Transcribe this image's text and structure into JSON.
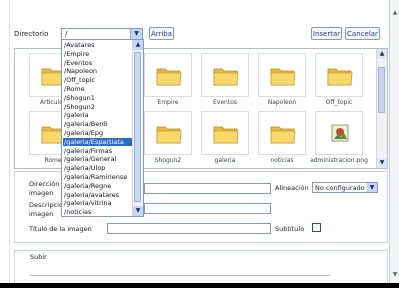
{
  "toolbar": {
    "directory_label": "Directorio",
    "directory_value": "/",
    "up_label": "Arriba",
    "insert_label": "Insertar",
    "cancel_label": "Cancelar"
  },
  "dropdown": {
    "items": [
      "/Avatares",
      "/Empire",
      "/Eventos",
      "/Napoleon",
      "/Off_topic",
      "/Rome",
      "/Shogun1",
      "/Shogun2",
      "/galeria",
      "/galeria/Berdi",
      "/galeria/Epg",
      "/galeria/Espartiata",
      "/galeria/Firmas",
      "/galeria/General",
      "/galeria/Ulop",
      "/galeria/Ramiriense",
      "/galeria/Regne",
      "/galeria/avatares",
      "/galeria/vitrina",
      "/noticias"
    ],
    "selected_index": 11
  },
  "files": {
    "row1": [
      "Articulos",
      "Empire",
      "Eventos",
      "Napoleon",
      "Off_topic"
    ],
    "row2": [
      "Rome",
      "Shogun2",
      "galeria",
      "noticias",
      "administracion.png"
    ]
  },
  "form": {
    "url_label": "Dirección URL de la imagen",
    "url_label_visible": "Dirección (",
    "url_label_2": "imagen",
    "desc_label": "Descripción",
    "desc_label_2": "imagen",
    "align_label": "Alineación",
    "align_value": "No configurado",
    "title_label": "Título de la imagen",
    "subtitle_label": "Subtítulo"
  },
  "upload": {
    "label": "Subir"
  },
  "colors": {
    "accent": "#316ac5",
    "link": "#1f3f8f",
    "folder": "#f2cf5e",
    "border": "#7f9db9"
  },
  "icons": {
    "folder": "folder-icon",
    "image": "image-file-icon"
  }
}
